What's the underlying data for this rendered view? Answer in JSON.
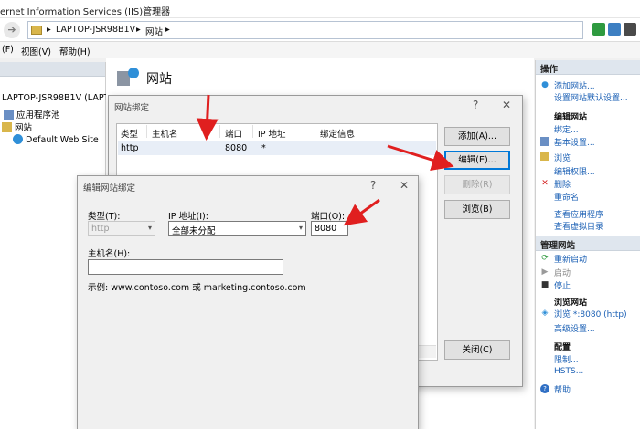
{
  "window": {
    "title": "ernet Information Services (IIS)管理器"
  },
  "address": {
    "crumbs": [
      "LAPTOP-JSR98B1V",
      "网站"
    ]
  },
  "menu": {
    "items": [
      "(F)",
      "视图(V)",
      "帮助(H)"
    ]
  },
  "tree": {
    "server": "LAPTOP-JSR98B1V (LAPTO",
    "app_pools": "应用程序池",
    "sites": "网站",
    "default_site": "Default Web Site"
  },
  "center": {
    "title": "网站"
  },
  "site_bindings": {
    "title": "网站绑定",
    "columns": [
      "类型",
      "主机名",
      "端口",
      "IP 地址",
      "绑定信息"
    ],
    "rows": [
      {
        "type": "http",
        "host": "",
        "port": "8080",
        "ip": "*",
        "info": ""
      }
    ],
    "buttons": {
      "add": "添加(A)...",
      "edit": "编辑(E)...",
      "remove": "删除(R)",
      "browse": "浏览(B)",
      "close": "关闭(C)"
    }
  },
  "edit_binding": {
    "title": "编辑网站绑定",
    "type_label": "类型(T):",
    "type_value": "http",
    "ip_label": "IP 地址(I):",
    "ip_value": "全部未分配",
    "port_label": "端口(O):",
    "port_value": "8080",
    "host_label": "主机名(H):",
    "host_value": "",
    "example": "示例: www.contoso.com 或 marketing.contoso.com"
  },
  "actions": {
    "header": "操作",
    "add_site": "添加网站...",
    "set_defaults": "设置网站默认设置...",
    "edit_site_header": "编辑网站",
    "bindings": "绑定...",
    "basic_settings": "基本设置...",
    "browse": "浏览",
    "edit_perms": "编辑权限...",
    "delete": "删除",
    "rename": "重命名",
    "view_apps": "查看应用程序",
    "view_vdirs": "查看虚拟目录",
    "manage_header": "管理网站",
    "restart": "重新启动",
    "start": "启动",
    "stop": "停止",
    "browse_site_header": "浏览网站",
    "browse_8080": "浏览 *:8080 (http)",
    "advanced": "高级设置...",
    "config_header": "配置",
    "limits": "限制...",
    "hsts": "HSTS...",
    "help": "帮助"
  },
  "colors": {
    "accent": "#0078d7",
    "arrow": "#e01f1f",
    "link": "#1a5fb4"
  }
}
